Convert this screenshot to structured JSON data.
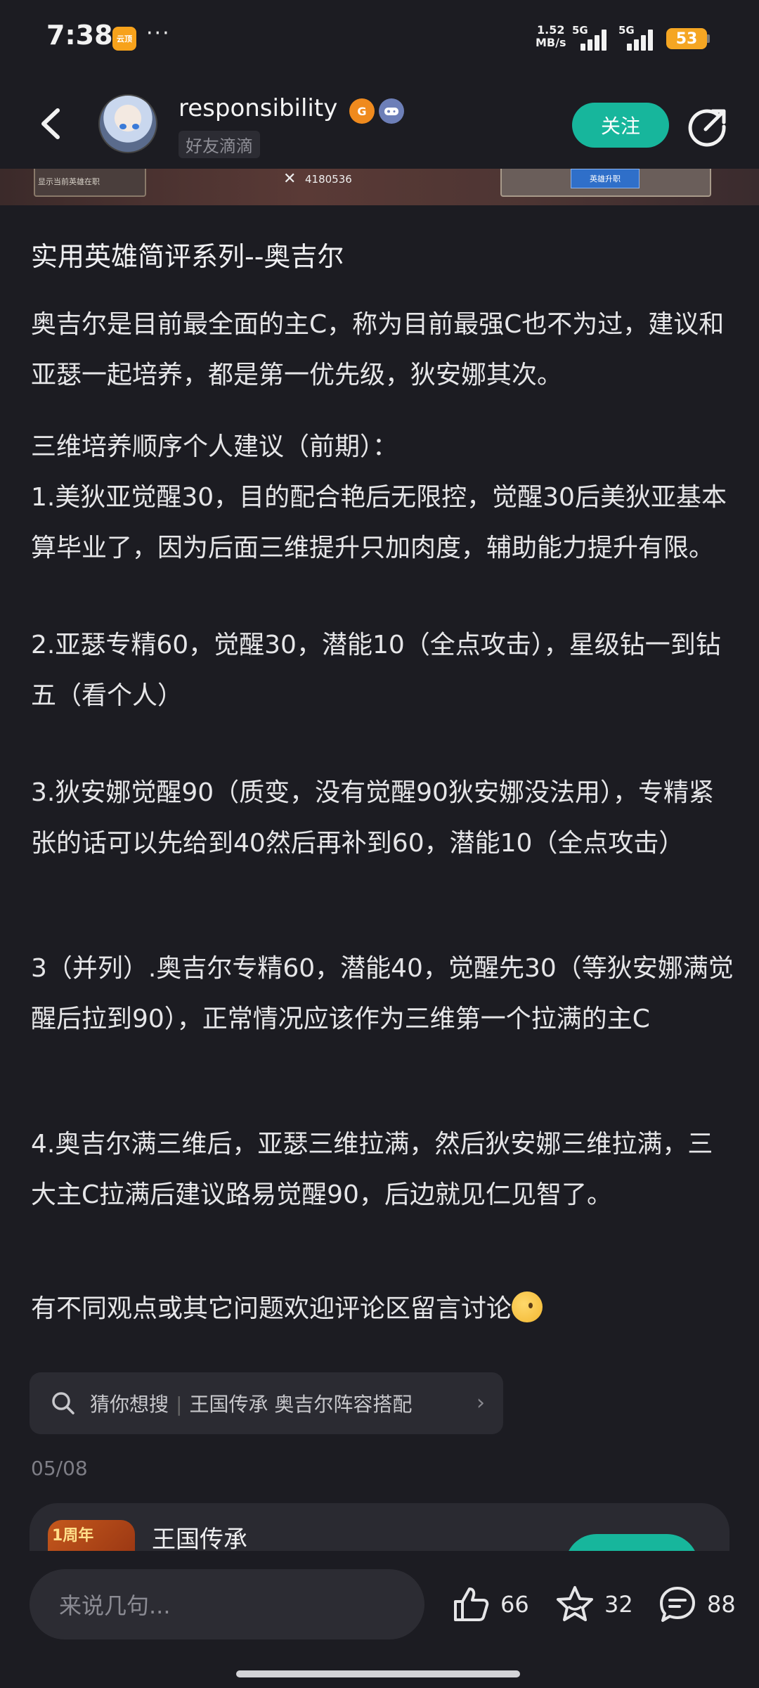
{
  "status_bar": {
    "time": "7:38",
    "app_badge": "云顶",
    "dots": "···",
    "net_speed_value": "1.52",
    "net_speed_unit": "MB/s",
    "signal1_label": "5G",
    "signal2_label": "5G",
    "battery": "53"
  },
  "header": {
    "username": "responsibility",
    "user_tag": "好友滴滴",
    "follow_label": "关注",
    "badge_icon": "badge-icon",
    "game_icon": "gamepad-icon"
  },
  "image_strip": {
    "left_panel_text": "显示当前英雄在职",
    "score": "4180536",
    "button_text": "英雄升职"
  },
  "article": {
    "title": "实用英雄简评系列--奥吉尔",
    "paragraphs": [
      "奥吉尔是目前最全面的主C，称为目前最强C也不为过，建议和亚瑟一起培养，都是第一优先级，狄安娜其次。",
      "三维培养顺序个人建议（前期）：",
      "1.美狄亚觉醒30，目的配合艳后无限控，觉醒30后美狄亚基本算毕业了，因为后面三维提升只加肉度，辅助能力提升有限。",
      "2.亚瑟专精60，觉醒30，潜能10（全点攻击），星级钻一到钻五（看个人）",
      "3.狄安娜觉醒90（质变，没有觉醒90狄安娜没法用），专精紧张的话可以先给到40然后再补到60，潜能10（全点攻击）",
      "3（并列）.奥吉尔专精60，潜能40，觉醒先30（等狄安娜满觉醒后拉到90），正常情况应该作为三维第一个拉满的主C",
      "4.奥吉尔满三维后，亚瑟三维拉满，然后狄安娜三维拉满，三大主C拉满后建议路易觉醒90，后边就见仁见智了。",
      "有不同观点或其它问题欢迎评论区留言讨论"
    ]
  },
  "search_suggest": {
    "prefix": "猜你想搜",
    "separator": "|",
    "query": "王国传承 奥吉尔阵容搭配"
  },
  "post_date": "05/08",
  "game_card": {
    "thumb_label": "1周年",
    "name": "王国传承"
  },
  "bottom_bar": {
    "comment_placeholder": "来说几句...",
    "likes": "66",
    "favorites": "32",
    "comments": "88"
  },
  "colors": {
    "background": "#1c1c22",
    "accent": "#17b69c",
    "battery": "#f5a623"
  }
}
